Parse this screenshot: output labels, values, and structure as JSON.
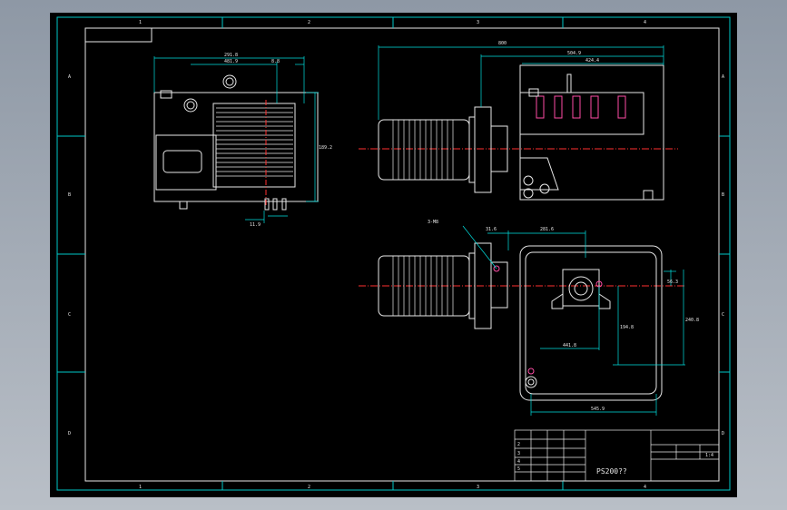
{
  "drawing": {
    "title": "PS200??",
    "border_labels": {
      "top": [
        "1",
        "2",
        "3",
        "4"
      ],
      "bottom": [
        "1",
        "2",
        "3",
        "4"
      ],
      "left": [
        "A",
        "B",
        "C",
        "D"
      ],
      "right": [
        "A",
        "B",
        "C",
        "D"
      ]
    },
    "dimensions": {
      "side_overall": "800",
      "side_d1": "504.9",
      "side_d2": "424.4",
      "front_width": "291.8",
      "front_d1": "481.9",
      "front_d2": "8.8",
      "front_height": "189.2",
      "front_bottom": "11.9",
      "plan_note": "3-M8",
      "plan_d1": "31.6",
      "plan_d2": "281.6",
      "plan_right": "56.3",
      "plan_h1": "194.8",
      "plan_h2": "240.8",
      "plan_inner": "441.8",
      "plan_bottom": "545.9"
    },
    "title_block": {
      "rows": [
        [
          "",
          "",
          "1:4",
          ""
        ],
        [
          "",
          "",
          "",
          ""
        ],
        [
          "",
          "",
          "",
          ""
        ]
      ],
      "left_rows": [
        "2",
        "3",
        "4",
        "5"
      ]
    }
  },
  "colors": {
    "sheet": "#000000",
    "frame": "#00c8c8",
    "geometry": "#ffffff",
    "dimension": "#00e0e0",
    "centerline": "#ff3030",
    "hidden": "#ff4da6"
  }
}
